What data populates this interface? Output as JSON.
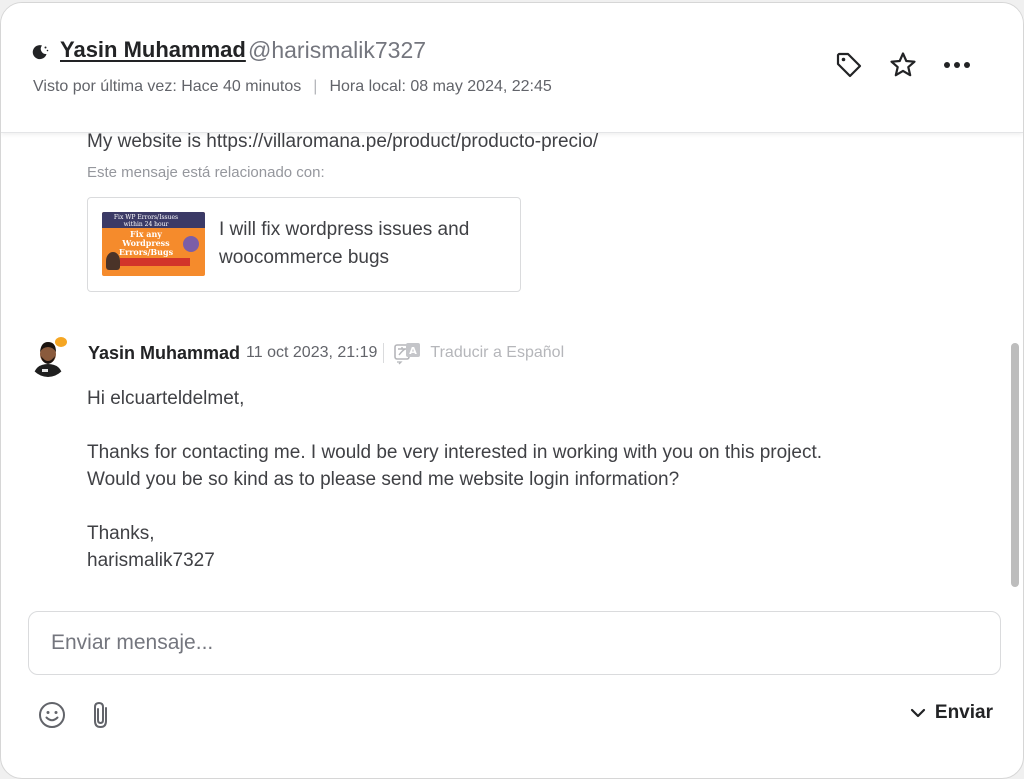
{
  "header": {
    "name": "Yasin Muhammad",
    "handle": "@harismalik7327",
    "last_seen": "Visto por última vez: Hace 40 minutos",
    "separator": "|",
    "local_time": "Hora local: 08 may 2024, 22:45",
    "actions": [
      "tag-icon",
      "star-icon",
      "more-icon"
    ]
  },
  "previous_message": {
    "text": "My website is https://villaromana.pe/product/producto-precio/",
    "related_label": "Este mensaje está relacionado con:",
    "gig": {
      "title": "I will fix wordpress issues and woocommerce bugs",
      "thumb_line1": "Fix WP Errors/Issues within 24 hour",
      "thumb_line2": "Fix any Wordpress Errors/Bugs"
    }
  },
  "message": {
    "sender": "Yasin Muhammad",
    "time": "11 oct 2023, 21:19",
    "translate_label": "Traducir a Español",
    "lines": [
      "Hi elcuarteldelmet,",
      "",
      "Thanks for contacting me. I would be very interested in working with you on this project.",
      "Would you be so kind as to please send me website login information?",
      "",
      "Thanks,",
      "harismalik7327"
    ]
  },
  "composer": {
    "placeholder": "Enviar mensaje...",
    "send_label": "Enviar"
  },
  "colors": {
    "accent_orange": "#f58b2c",
    "text_dark": "#222325",
    "text_body": "#404145",
    "text_muted": "#74767e"
  }
}
